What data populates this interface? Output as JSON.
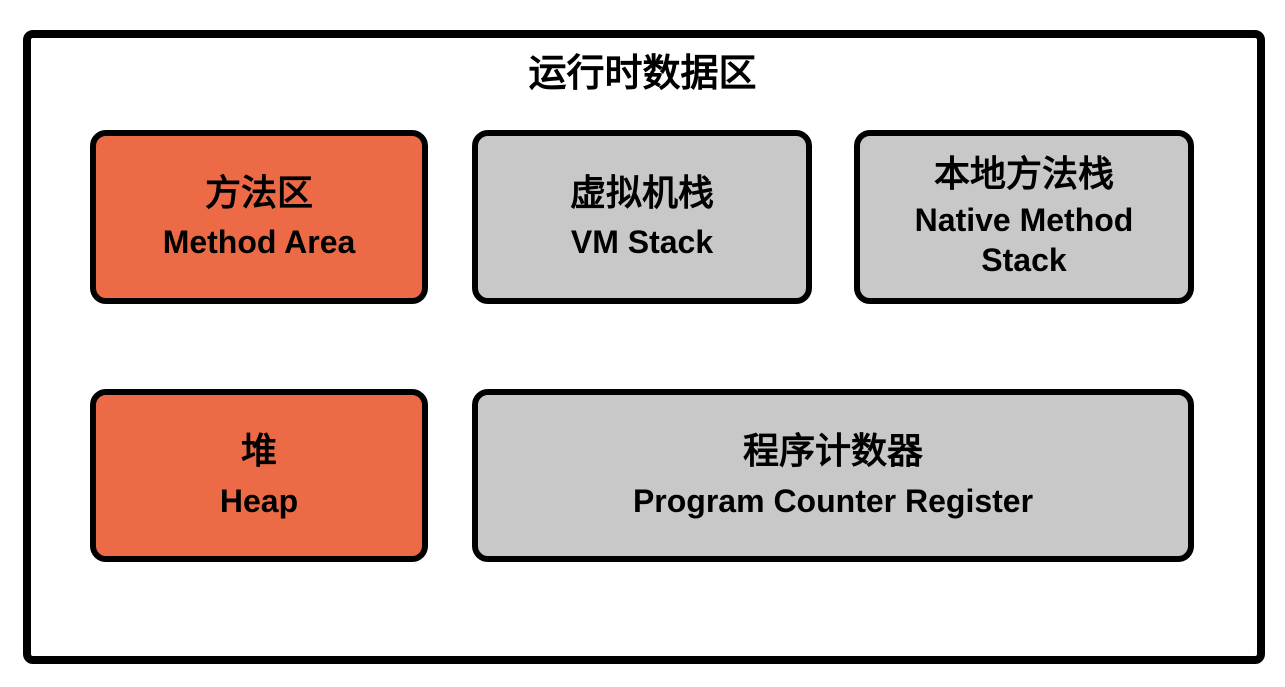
{
  "title": "运行时数据区",
  "areas": [
    {
      "cn": "方法区",
      "en": "Method Area",
      "color": "#ec6a45"
    },
    {
      "cn": "虚拟机栈",
      "en": "VM Stack",
      "color": "#c8c8c8"
    },
    {
      "cn": "本地方法栈",
      "en": "Native Method Stack",
      "color": "#c8c8c8"
    },
    {
      "cn": "堆",
      "en": "Heap",
      "color": "#ec6a45"
    },
    {
      "cn": "程序计数器",
      "en": "Program Counter Register",
      "color": "#c8c8c8"
    }
  ]
}
